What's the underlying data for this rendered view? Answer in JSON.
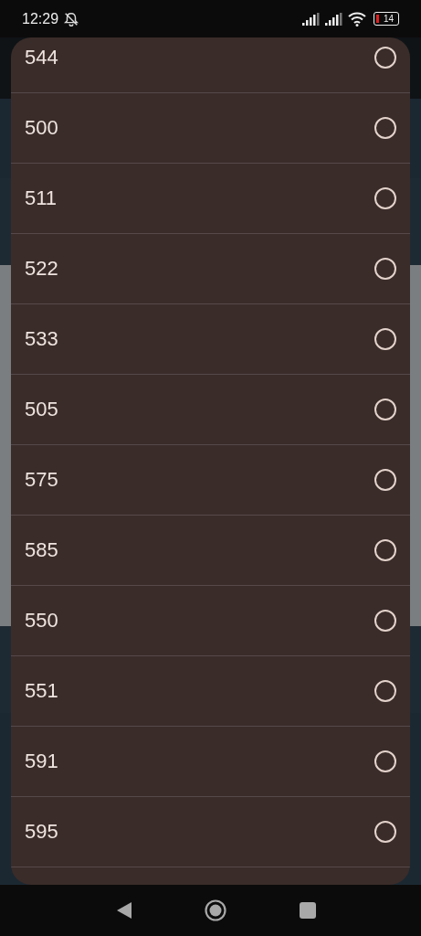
{
  "status_bar": {
    "time": "12:29",
    "battery": "14"
  },
  "options": [
    {
      "label": "544",
      "selected": false
    },
    {
      "label": "500",
      "selected": false
    },
    {
      "label": "511",
      "selected": false
    },
    {
      "label": "522",
      "selected": false
    },
    {
      "label": "533",
      "selected": false
    },
    {
      "label": "505",
      "selected": false
    },
    {
      "label": "575",
      "selected": false
    },
    {
      "label": "585",
      "selected": false
    },
    {
      "label": "550",
      "selected": false
    },
    {
      "label": "551",
      "selected": false
    },
    {
      "label": "591",
      "selected": false
    },
    {
      "label": "595",
      "selected": false
    }
  ]
}
